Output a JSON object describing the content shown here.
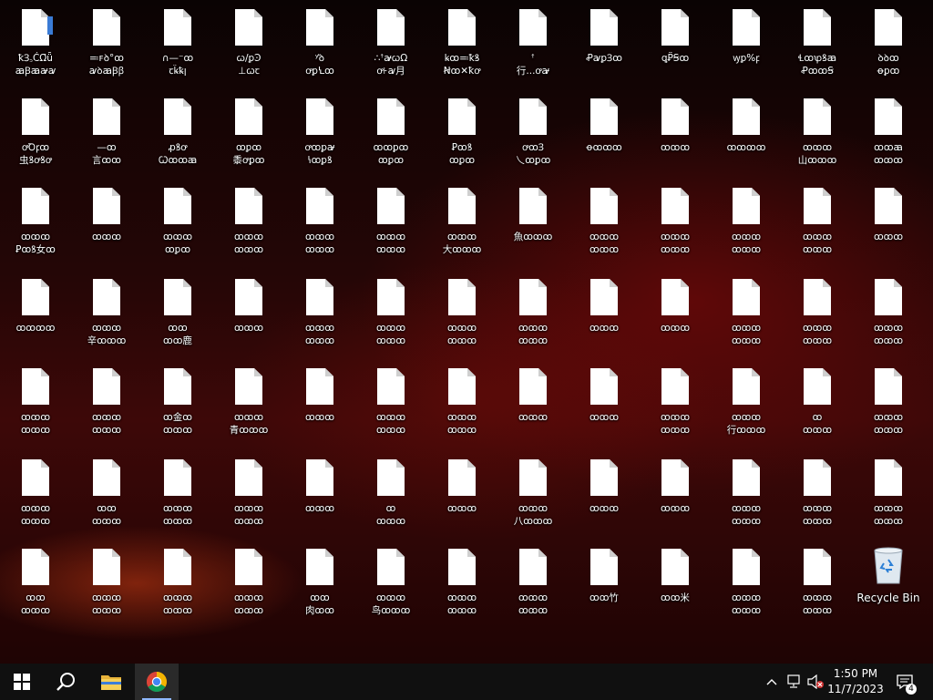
{
  "desktop": {
    "icons": [
      [
        "ꝁꞫ꜆ĆΩ̈ǖ\nꜳꞴꜳꜻꜹ",
        "≕ꜰꝺ°ꝏ\nꜹꝺꜳꞴꞵ",
        "∩—⁻ꝏ\nꞇꝃ̈ꝅꞁ",
        "ꞷ/ꝑꜾ\n⊥ꞷꞇ",
        "ʸꜙꝺ\nꝍꝑꝆꝏ",
        "∴ꜛꜻꞷΩ\nꝍ꜔ꜹ月",
        "ꝃꝏ≕ꝁꝸ\nꞤꝏ✕ꝁꝍ",
        "ꜛ\n行...ꝍꜻ",
        "ꝒꜹꝑꞫꝏ",
        "ꝗꝐ̈Ꞩꝏ",
        "ꝡꝑ%ꝼ",
        "Ɬꝏꝕꝸꜳ\nꝒꝏꝏꞨ",
        "ꝺꝺꝏ\nꝋꝑꝏ"
      ],
      [
        "ꝍꝹꝼꝏ\n虫ꝸꝍꝸꝍ",
        "—ꝏ\n言ꝏꝏ",
        "ꝓꝸꝍ\nꞶꝏꝏꜳ",
        "ꝏꝑꝏ\n黍ꝍꝑꝏ",
        "ꝍꝏꝑꜻ\nꝇꝏꝑꝸ",
        "ꝏꝏꝑꝏ\nꝏꝑꝏ",
        "Ꝑꝏꝸ\nꝏꝑꝏ",
        "ꝍꝏꞫ\n乀ꝏꝑꝏ",
        "ꝋꝏꝏꝏ",
        "ꝏꝏꝏ",
        "ꝏꝏꝏꝏ",
        "ꝏꝏꝏ\n山ꝏꝏꝏ",
        "ꝏꝏꜳ\nꝏꝏꝏ"
      ],
      [
        "ꝏꝏꝏ\nꝐꝏꝸ女ꝏ",
        "ꝏꝏꝏ",
        "ꝏꝏꝏ\nꝏꝑꝏ",
        "ꝏꝏꝏ\nꝏꝏꝏ",
        "ꝏꝏꝏ\nꝏꝏꝏ",
        "ꝏꝏꝏ\nꝏꝏꝏ",
        "ꝏꝏꝏ\n大ꝏꝏꝏ",
        "魚ꝏꝏꝏ",
        "ꝏꝏꝏ\nꝏꝏꝏ",
        "ꝏꝏꝏ\nꝏꝏꝏ",
        "ꝏꝏꝏ\nꝏꝏꝏ",
        "ꝏꝏꝏ\nꝏꝏꝏ",
        "ꝏꝏꝏ"
      ],
      [
        "ꝏꝏꝏꝏ",
        "ꝏꝏꝏ\n辛ꝏꝏꝏ",
        "ꝏꝏ\nꝏꝏ鹿",
        "ꝏꝏꝏ",
        "ꝏꝏꝏ\nꝏꝏꝏ",
        "ꝏꝏꝏ\nꝏꝏꝏ",
        "ꝏꝏꝏ\nꝏꝏꝏ",
        "ꝏꝏꝏ\nꝏꝏꝏ",
        "ꝏꝏꝏ",
        "ꝏꝏꝏ",
        "ꝏꝏꝏ\nꝏꝏꝏ",
        "ꝏꝏꝏ\nꝏꝏꝏ",
        "ꝏꝏꝏ\nꝏꝏꝏ"
      ],
      [
        "ꝏꝏꝏ\nꝏꝏꝏ",
        "ꝏꝏꝏ\nꝏꝏꝏ",
        "ꝏ金ꝏ\nꝏꝏꝏ",
        "ꝏꝏꝏ\n青ꝏꝏꝏ",
        "ꝏꝏꝏ",
        "ꝏꝏꝏ\nꝏꝏꝏ",
        "ꝏꝏꝏ\nꝏꝏꝏ",
        "ꝏꝏꝏ",
        "ꝏꝏꝏ",
        "ꝏꝏꝏ\nꝏꝏꝏ",
        "ꝏꝏꝏ\n行ꝏꝏꝏ",
        "ꝏ\nꝏꝏꝏ",
        "ꝏꝏꝏ\nꝏꝏꝏ"
      ],
      [
        "ꝏꝏꝏ\nꝏꝏꝏ",
        "ꝏꝏ\nꝏꝏꝏ",
        "ꝏꝏꝏ\nꝏꝏꝏ",
        "ꝏꝏꝏ\nꝏꝏꝏ",
        "ꝏꝏꝏ",
        "ꝏ\nꝏꝏꝏ",
        "ꝏꝏꝏ",
        "ꝏꝏꝏ\n八ꝏꝏꝏ",
        "ꝏꝏꝏ",
        "ꝏꝏꝏ",
        "ꝏꝏꝏ\nꝏꝏꝏ",
        "ꝏꝏꝏ\nꝏꝏꝏ",
        "ꝏꝏꝏ\nꝏꝏꝏ"
      ],
      [
        "ꝏꝏ\nꝏꝏꝏ",
        "ꝏꝏꝏ\nꝏꝏꝏ",
        "ꝏꝏꝏ\nꝏꝏꝏ",
        "ꝏꝏꝏ\nꝏꝏꝏ",
        "ꝏꝏ\n肉ꝏꝏ",
        "ꝏꝏꝏ\n鸟ꝏꝏꝏ",
        "ꝏꝏꝏ\nꝏꝏꝏ",
        "ꝏꝏꝏ\nꝏꝏꝏ",
        "ꝏꝏ竹",
        "ꝏꝏ米",
        "ꝏꝏꝏ\nꝏꝏꝏ",
        "ꝏꝏꝏ\nꝏꝏꝏ"
      ]
    ],
    "recycle_bin_label": "Recycle Bin"
  },
  "taskbar": {
    "clock_time": "1:50 PM",
    "clock_date": "11/7/2023",
    "notification_count": "4",
    "start_icon": "windows-logo",
    "search_icon": "search",
    "file_explorer_icon": "folder",
    "chrome_icon": "chrome"
  },
  "colors": {
    "taskbar_bg": "#101010",
    "accent": "#8fb8ff"
  }
}
